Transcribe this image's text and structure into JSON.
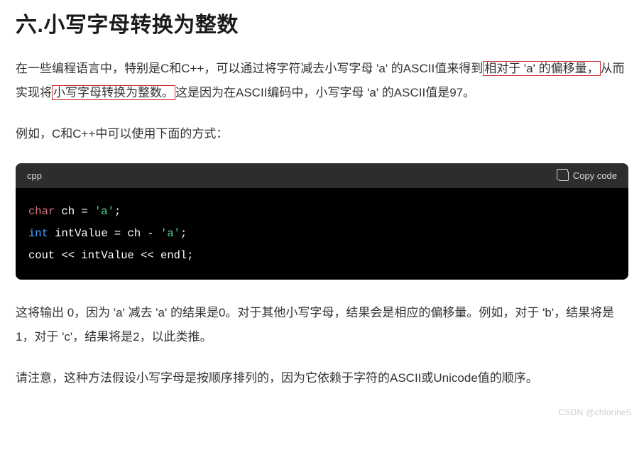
{
  "heading": "六.小写字母转换为整数",
  "para1": {
    "pre": "在一些编程语言中，特别是C和C++，可以通过将字符减去小写字母 'a' 的ASCII值来得到",
    "hl1": "相对于 'a' 的偏移量，",
    "mid": "从而实现将",
    "hl2": "小写字母转换为整数。",
    "post": "这是因为在ASCII编码中，小写字母 'a' 的ASCII值是97。"
  },
  "para2": "例如，C和C++中可以使用下面的方式：",
  "code": {
    "lang": "cpp",
    "copy_label": "Copy code",
    "line1": {
      "kw": "char",
      "rest": " ch = ",
      "str": "'a'",
      "end": ";"
    },
    "line2": {
      "kw": "int",
      "rest": " intValue = ch - ",
      "str": "'a'",
      "end": ";"
    },
    "line3": {
      "plain": "cout << intValue << endl;"
    }
  },
  "para3": "这将输出 0，因为 'a' 减去 'a' 的结果是0。对于其他小写字母，结果会是相应的偏移量。例如，对于 'b'，结果将是1，对于 'c'，结果将是2，以此类推。",
  "para4": "请注意，这种方法假设小写字母是按顺序排列的，因为它依赖于字符的ASCII或Unicode值的顺序。",
  "watermark": "CSDN @chlorine5"
}
